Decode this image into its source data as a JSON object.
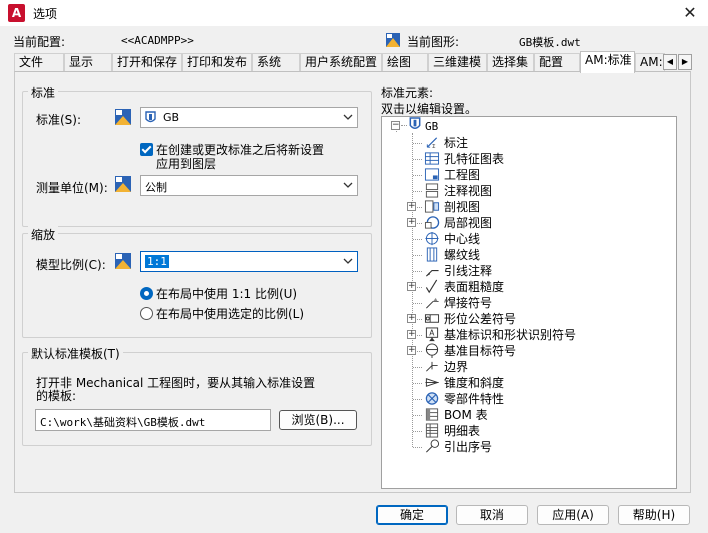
{
  "window": {
    "title": "选项",
    "app_icon_letter": "A",
    "close_glyph": "✕"
  },
  "profile": {
    "current_profile_label": "当前配置:",
    "current_profile_value": "<<ACADMPP>>",
    "current_drawing_label": "当前图形:",
    "current_drawing_value": "GB模板.dwt"
  },
  "tabs": [
    {
      "label": "文件"
    },
    {
      "label": "显示"
    },
    {
      "label": "打开和保存"
    },
    {
      "label": "打印和发布"
    },
    {
      "label": "系统"
    },
    {
      "label": "用户系统配置"
    },
    {
      "label": "绘图"
    },
    {
      "label": "三维建模"
    },
    {
      "label": "选择集"
    },
    {
      "label": "配置"
    },
    {
      "label": "AM:标准"
    },
    {
      "label": "AM:"
    }
  ],
  "standard_group": {
    "title": "标准",
    "standard_label": "标准(S):",
    "standard_value": "GB",
    "checkbox_label_line1": "在创建或更改标准之后将新设置",
    "checkbox_label_line2": "应用到图层",
    "measure_label": "测量单位(M):",
    "measure_value": "公制"
  },
  "scale_group": {
    "title": "缩放",
    "model_scale_label": "模型比例(C):",
    "model_scale_value": "1:1",
    "radio1_label": "在布局中使用 1:1 比例(U)",
    "radio2_label": "在布局中使用选定的比例(L)"
  },
  "template_group": {
    "title": "默认标准模板(T)",
    "desc_line1": "打开非 Mechanical 工程图时，要从其输入标准设置",
    "desc_line2": "的模板:",
    "path_value": "C:\\work\\基础资料\\GB模板.dwt",
    "browse_label": "浏览(B)..."
  },
  "elements": {
    "title": "标准元素:",
    "hint": "双击以编辑设置。",
    "root": "GB",
    "items": [
      {
        "label": "标注",
        "expandable": false,
        "icon": "dimension-icon"
      },
      {
        "label": "孔特征图表",
        "expandable": false,
        "icon": "hole-chart-icon"
      },
      {
        "label": "工程图",
        "expandable": false,
        "icon": "drawing-icon"
      },
      {
        "label": "注释视图",
        "expandable": false,
        "icon": "annotation-view-icon"
      },
      {
        "label": "剖视图",
        "expandable": true,
        "icon": "section-view-icon"
      },
      {
        "label": "局部视图",
        "expandable": true,
        "icon": "detail-view-icon"
      },
      {
        "label": "中心线",
        "expandable": false,
        "icon": "centerline-icon"
      },
      {
        "label": "螺纹线",
        "expandable": false,
        "icon": "thread-icon"
      },
      {
        "label": "引线注释",
        "expandable": false,
        "icon": "leader-note-icon"
      },
      {
        "label": "表面粗糙度",
        "expandable": true,
        "icon": "surface-texture-icon"
      },
      {
        "label": "焊接符号",
        "expandable": false,
        "icon": "weld-symbol-icon"
      },
      {
        "label": "形位公差符号",
        "expandable": true,
        "icon": "feature-control-icon"
      },
      {
        "label": "基准标识和形状识别符号",
        "expandable": true,
        "icon": "datum-identifier-icon"
      },
      {
        "label": "基准目标符号",
        "expandable": true,
        "icon": "datum-target-icon"
      },
      {
        "label": "边界",
        "expandable": false,
        "icon": "edge-icon"
      },
      {
        "label": "锥度和斜度",
        "expandable": false,
        "icon": "taper-slope-icon"
      },
      {
        "label": "零部件特性",
        "expandable": false,
        "icon": "component-property-icon"
      },
      {
        "label": "BOM 表",
        "expandable": false,
        "icon": "bom-icon"
      },
      {
        "label": "明细表",
        "expandable": false,
        "icon": "parts-list-icon"
      },
      {
        "label": "引出序号",
        "expandable": false,
        "icon": "balloon-icon"
      }
    ]
  },
  "buttons": {
    "ok": "确定",
    "cancel": "取消",
    "apply": "应用(A)",
    "help": "帮助(H)"
  },
  "colors": {
    "accent": "#0067c0",
    "selection": "#0078d7",
    "app_red": "#c8102e"
  }
}
